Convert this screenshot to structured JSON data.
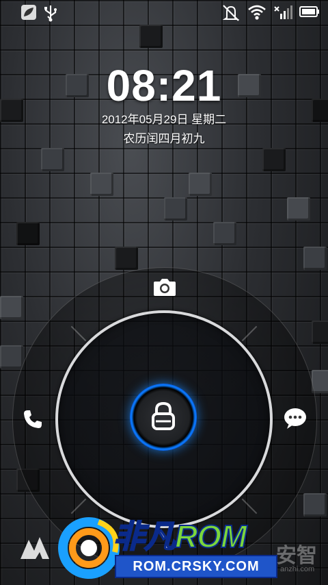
{
  "status_bar": {
    "icons": [
      "leaf-icon",
      "usb-icon",
      "silent-mode-icon",
      "wifi-icon",
      "signal-icon",
      "battery-icon"
    ]
  },
  "lockscreen": {
    "time": "08:21",
    "date": "2012年05月29日 星期二",
    "lunar_date": "农历闰四月初九"
  },
  "unlock": {
    "top_target": "camera-icon",
    "left_target": "phone-icon",
    "right_target": "message-icon",
    "center": "lock-icon",
    "accent_color": "#0a7cff"
  },
  "watermark": {
    "brand_prefix": "非凡",
    "brand_rom": "ROM",
    "url": "ROM.CRSKY.COM",
    "partner": "安智",
    "partner_small": "anzhi.com"
  }
}
